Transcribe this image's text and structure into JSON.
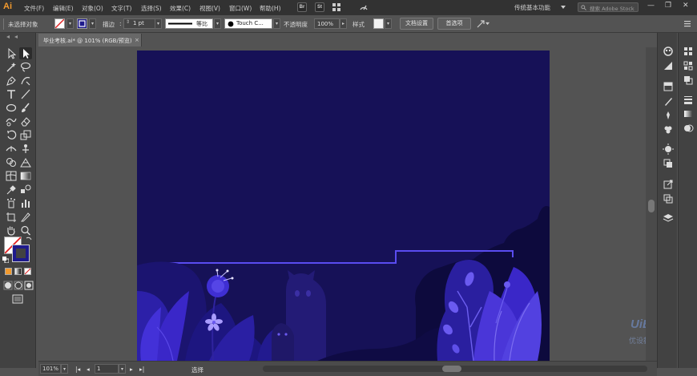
{
  "app": {
    "logo": "Ai"
  },
  "menubar": {
    "items": [
      "文件(F)",
      "编辑(E)",
      "对象(O)",
      "文字(T)",
      "选择(S)",
      "效果(C)",
      "视图(V)",
      "窗口(W)",
      "帮助(H)"
    ],
    "badges": [
      "Br",
      "St"
    ],
    "workspace": "传统基本功能",
    "search_placeholder": "搜索 Adobe Stock",
    "window_buttons": [
      "—",
      "❐",
      "✕"
    ]
  },
  "controlbar": {
    "selection_label": "未选择对象",
    "stroke_label": "描边",
    "stroke_value": "1 pt",
    "brush_label": "等比",
    "brush_name": "Touch C...",
    "opacity_label": "不透明度",
    "opacity_value": "100%",
    "style_label": "样式",
    "doc_setup_button": "文档设置",
    "preferences_button": "首选项"
  },
  "document_tab": {
    "title": "毕业考核.ai* @ 101% (RGB/预览)",
    "close": "×"
  },
  "statusbar": {
    "zoom": "101%",
    "page": "1",
    "status": "选择"
  },
  "watermark": {
    "logo_text": "UiBQ",
    "sub_text": "优设教程网"
  },
  "colors": {
    "accent": "#f29a2e",
    "artboard_bg": "#161157",
    "stroke_line": "#5a4cf0",
    "plant_bright": "#3a27c8",
    "plant_dark": "#0f0b44"
  }
}
